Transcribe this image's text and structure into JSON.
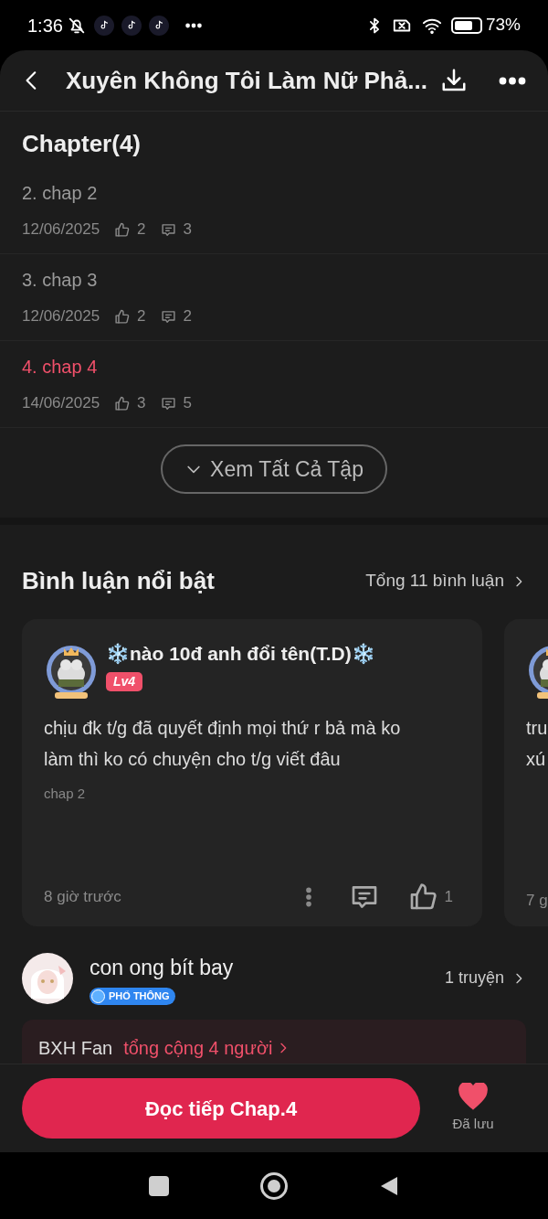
{
  "status_bar": {
    "time": "1:36",
    "battery_percent": "73%"
  },
  "header": {
    "title": "Xuyên Không Tôi Làm Nữ Phả..."
  },
  "chapters": {
    "title": "Chapter(4)",
    "items": [
      {
        "title": "2. chap 2",
        "date": "12/06/2025",
        "likes": "2",
        "comments": "3",
        "selected": false
      },
      {
        "title": "3. chap 3",
        "date": "12/06/2025",
        "likes": "2",
        "comments": "2",
        "selected": false
      },
      {
        "title": "4. chap 4",
        "date": "14/06/2025",
        "likes": "3",
        "comments": "5",
        "selected": true
      }
    ],
    "view_all": "Xem Tất Cả Tập"
  },
  "comments": {
    "title": "Bình luận nổi bật",
    "total": "Tổng 11 bình luận",
    "items": [
      {
        "user": "❄️nào 10đ anh đổi tên(T.D)❄️",
        "level": "Lv4",
        "text": "chịu đk t/g đã quyết định mọi thứ r bả mà ko làm thì ko có chuyện cho t/g viết đâu",
        "chapter": "chap 2",
        "time": "8 giờ trước",
        "likes": "1"
      }
    ],
    "next_card": {
      "text_line_1": "tru",
      "text_line_2": "xú",
      "time": "7 g"
    }
  },
  "author": {
    "name": "con ong bít bay",
    "badge": "PHỔ THÔNG",
    "stories": "1 truyện",
    "fan_label": "BXH Fan",
    "fan_total": "tổng cộng 4 người"
  },
  "bottom_bar": {
    "read_button": "Đọc tiếp Chap.4",
    "saved_label": "Đã lưu",
    "saved": true
  }
}
